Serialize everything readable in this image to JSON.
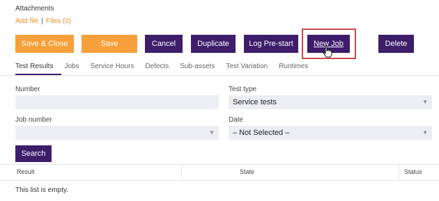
{
  "attachments": {
    "title": "Attachments",
    "add_file": "Add file",
    "separator": "|",
    "files": "Files (0)"
  },
  "toolbar": {
    "save_close": "Save & Close",
    "save": "Save",
    "cancel": "Cancel",
    "duplicate": "Duplicate",
    "log_prestart": "Log Pre-start",
    "new_job": "New Job",
    "delete": "Delete"
  },
  "tabs": [
    {
      "label": "Test Results",
      "active": true
    },
    {
      "label": "Jobs"
    },
    {
      "label": "Service Hours"
    },
    {
      "label": "Defects"
    },
    {
      "label": "Sub-assets"
    },
    {
      "label": "Test Variation"
    },
    {
      "label": "Runtimes"
    }
  ],
  "form": {
    "number_label": "Number",
    "number_value": "",
    "test_type_label": "Test type",
    "test_type_value": "Service tests",
    "job_number_label": "Job number",
    "job_number_value": "",
    "date_label": "Date",
    "date_value": "– Not Selected –"
  },
  "search_label": "Search",
  "results": {
    "columns": [
      "Result",
      "State",
      "Status"
    ],
    "empty_text": "This list is empty."
  },
  "colors": {
    "accent_orange": "#f5a03a",
    "primary_purple": "#3e1d6b",
    "highlight_red": "#c94a4a"
  }
}
